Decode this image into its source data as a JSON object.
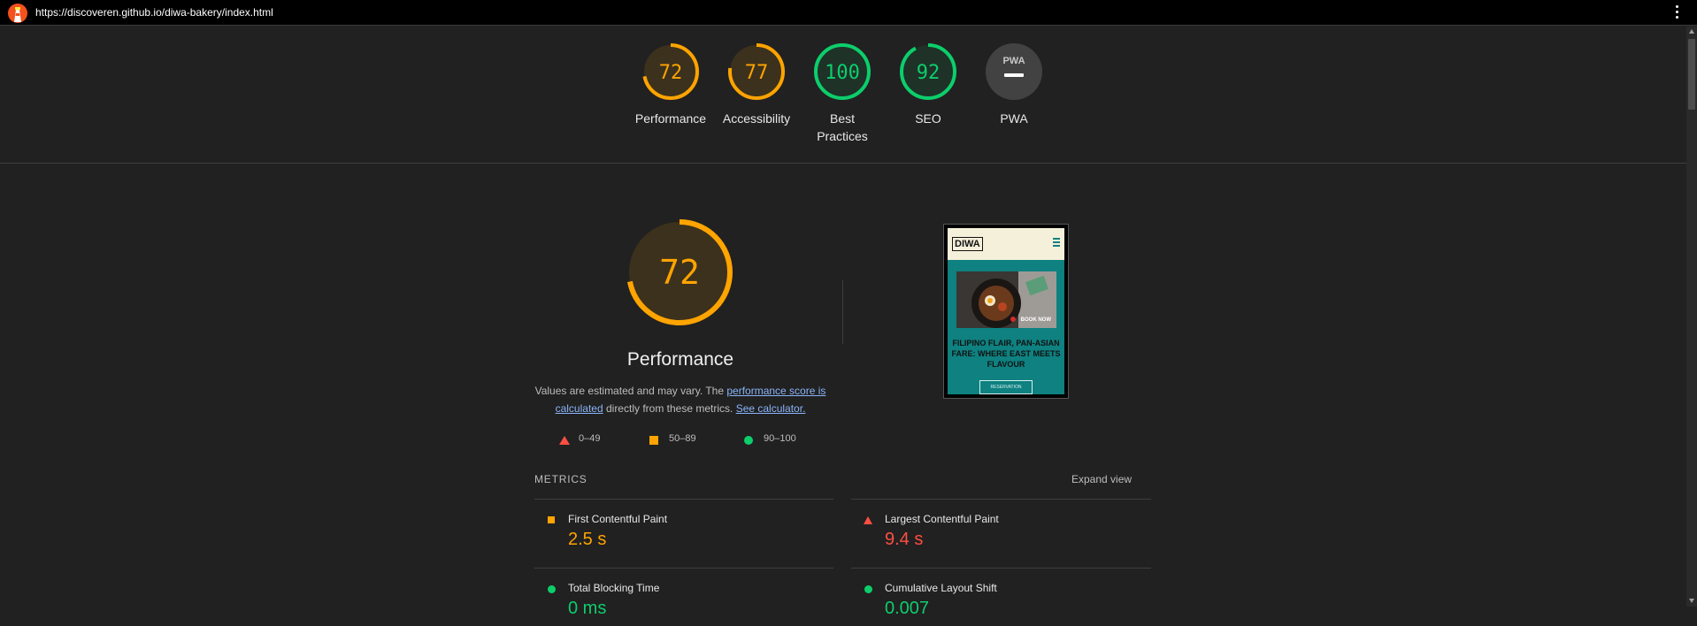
{
  "topbar": {
    "url": "https://discoveren.github.io/diwa-bakery/index.html"
  },
  "colors": {
    "average": "#ffa400",
    "fail": "#ff4e42",
    "pass": "#0cce6b",
    "bg": "#212121"
  },
  "gauges": [
    {
      "label": "Performance",
      "score": 72,
      "status": "average"
    },
    {
      "label": "Accessibility",
      "score": 77,
      "status": "average"
    },
    {
      "label": "Best Practices",
      "score": 100,
      "status": "pass"
    },
    {
      "label": "SEO",
      "score": 92,
      "status": "pass"
    },
    {
      "label": "PWA",
      "score": null,
      "status": "na",
      "badge": "PWA"
    }
  ],
  "performance": {
    "score": 72,
    "title": "Performance",
    "desc_prefix": "Values are estimated and may vary. The ",
    "desc_link1": "performance score is calculated",
    "desc_middle": " directly from these metrics. ",
    "desc_link2": "See calculator."
  },
  "legend": [
    {
      "shape": "triangle",
      "range": "0–49"
    },
    {
      "shape": "square",
      "range": "50–89"
    },
    {
      "shape": "circle",
      "range": "90–100"
    }
  ],
  "thumbnail": {
    "brand": "DIWA",
    "book_label": "BOOK NOW",
    "headline": "FILIPINO FLAIR, PAN-ASIAN FARE: WHERE EAST MEETS FLAVOUR",
    "button": "RESERVATION"
  },
  "metrics": {
    "title": "METRICS",
    "expand": "Expand view",
    "items": [
      {
        "name": "First Contentful Paint",
        "value": "2.5 s",
        "status": "average"
      },
      {
        "name": "Largest Contentful Paint",
        "value": "9.4 s",
        "status": "fail"
      },
      {
        "name": "Total Blocking Time",
        "value": "0 ms",
        "status": "pass"
      },
      {
        "name": "Cumulative Layout Shift",
        "value": "0.007",
        "status": "pass"
      }
    ]
  }
}
